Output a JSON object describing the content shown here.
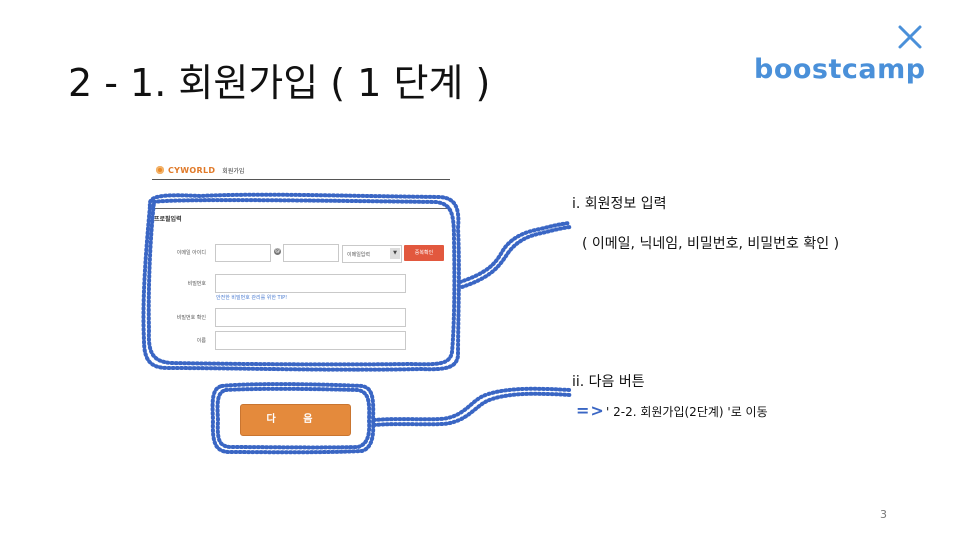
{
  "slide": {
    "title": "2 - 1. 회원가입 ( 1 단계 )",
    "page_number": "3"
  },
  "logo": {
    "text": "boostcamp",
    "mark_icon": "x-mark-icon",
    "color": "#4a90d9"
  },
  "form": {
    "brand": "CYWORLD",
    "header_title": "회원가입",
    "section_label": "프로필입력",
    "rows": {
      "email_label": "이메일 아이디",
      "password_label": "비밀번호",
      "password_confirm_label": "비밀번호 확인",
      "name_label": "이름"
    },
    "email_domain_select": "이메일입력",
    "dup_check_button": "중복확인",
    "password_tip": "안전한 비밀번호 관리를 위한 TIP!",
    "next_button": "다 음"
  },
  "annotations": {
    "item1_title": "i. 회원정보 입력",
    "item1_detail": "( 이메일, 닉네임, 비밀번호, 비밀번호 확인 )",
    "item2_title": "ii. 다음 버튼",
    "item2_arrow": "=>",
    "item2_detail": "' 2-2. 회원가입(2단계) '로 이동",
    "highlight_color": "#3a66c4"
  }
}
